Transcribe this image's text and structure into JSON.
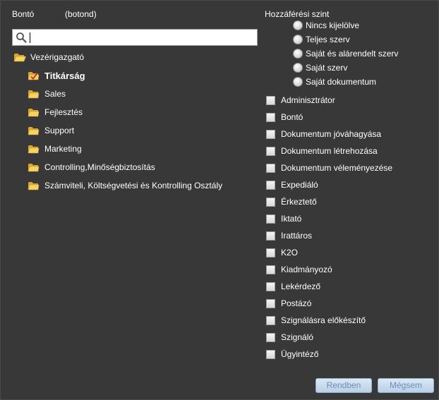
{
  "user": {
    "name": "Bontó",
    "login": "(botond)"
  },
  "search": {
    "value": "",
    "placeholder": ""
  },
  "tree": {
    "root": "Vezérigazgató",
    "children": [
      {
        "label": "Titkárság",
        "selected": true
      },
      {
        "label": "Sales"
      },
      {
        "label": "Fejlesztés"
      },
      {
        "label": "Support"
      },
      {
        "label": "Marketing"
      },
      {
        "label": "Controlling,Minőségbiztosítás"
      },
      {
        "label": "Számviteli, Költségvetési és Kontrolling Osztály"
      }
    ]
  },
  "access": {
    "title": "Hozzáférési szint",
    "options": [
      "Nincs kijelölve",
      "Teljes szerv",
      "Saját és alárendelt szerv",
      "Saját szerv",
      "Saját dokumentum"
    ]
  },
  "roles": [
    "Adminisztrátor",
    "Bontó",
    "Dokumentum jóváhagyása",
    "Dokumentum létrehozása",
    "Dokumentum véleményezése",
    "Expediáló",
    "Érkeztető",
    "Iktató",
    "Irattáros",
    "K2O",
    "Kiadmányozó",
    "Lekérdező",
    "Postázó",
    "Szignálásra előkészítő",
    "Szignáló",
    "Ügyintéző"
  ],
  "buttons": {
    "ok": "Rendben",
    "cancel": "Mégsem"
  },
  "colors": {
    "background": "#383838",
    "folder": "#f2c94c",
    "button_text": "#6b8fb4"
  }
}
